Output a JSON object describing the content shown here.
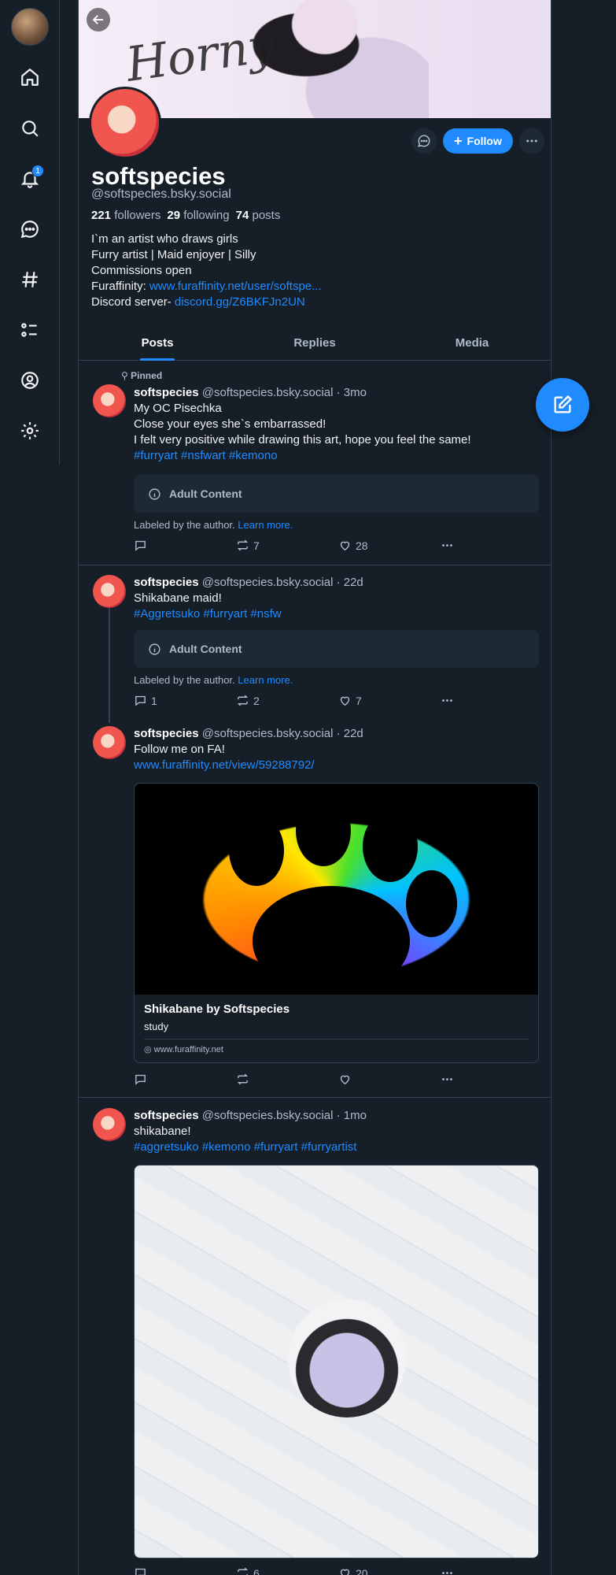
{
  "nav": {
    "items": [
      "home",
      "search",
      "notifications",
      "chat",
      "feeds",
      "lists",
      "profile",
      "settings"
    ],
    "notifications_badge": "1"
  },
  "profile": {
    "display_name": "softspecies",
    "handle": "@softspecies.bsky.social",
    "followers_count": "221",
    "followers_label": "followers",
    "following_count": "29",
    "following_label": "following",
    "posts_count": "74",
    "posts_label": "posts",
    "follow_label": "Follow",
    "bio": {
      "line1": "I`m an artist who draws girls",
      "line2": "Furry artist | Maid enjoyer | Silly",
      "line3": "Commissions open",
      "fa_prefix": "Furaffinity: ",
      "fa_link": "www.furaffinity.net/user/softspe...",
      "discord_prefix": "Discord server- ",
      "discord_link": "discord.gg/Z6BKFJn2UN"
    },
    "banner_text": "Horny"
  },
  "tabs": [
    "Posts",
    "Replies",
    "Media"
  ],
  "posts": [
    {
      "pinned_label": "Pinned",
      "author": "softspecies",
      "handle": "@softspecies.bsky.social",
      "time": "· 3mo",
      "lines": [
        "My OC Pisechka",
        "Close your eyes she`s embarrassed!",
        "I felt very positive while drawing this art, hope you feel the same!"
      ],
      "tags": "#furryart #nsfwart #kemono",
      "adult_label": "Adult Content",
      "labeled_text": "Labeled by the author.",
      "learn_more": "Learn more.",
      "replies": "",
      "reposts": "7",
      "likes": "28"
    },
    {
      "author": "softspecies",
      "handle": "@softspecies.bsky.social",
      "time": "· 22d",
      "lines": [
        "Shikabane maid!"
      ],
      "tags": "#Aggretsuko #furryart #nsfw",
      "adult_label": "Adult Content",
      "labeled_text": "Labeled by the author.",
      "learn_more": "Learn more.",
      "replies": "1",
      "reposts": "2",
      "likes": "7"
    },
    {
      "author": "softspecies",
      "handle": "@softspecies.bsky.social",
      "time": "· 22d",
      "lines": [
        "Follow me on FA!"
      ],
      "link": "www.furaffinity.net/view/59288792/",
      "card_title": "Shikabane by Softspecies",
      "card_desc": "study",
      "card_domain": "www.furaffinity.net",
      "replies": "",
      "reposts": "",
      "likes": ""
    },
    {
      "author": "softspecies",
      "handle": "@softspecies.bsky.social",
      "time": "· 1mo",
      "lines": [
        "shikabane!"
      ],
      "tags": "#aggretsuko #kemono #furryart #furryartist",
      "replies": "",
      "reposts": "6",
      "likes": "20"
    }
  ],
  "colors": {
    "background": "#161e27",
    "accent": "#208bfe",
    "border": "#2e4052",
    "muted_text": "#aebbc9"
  }
}
